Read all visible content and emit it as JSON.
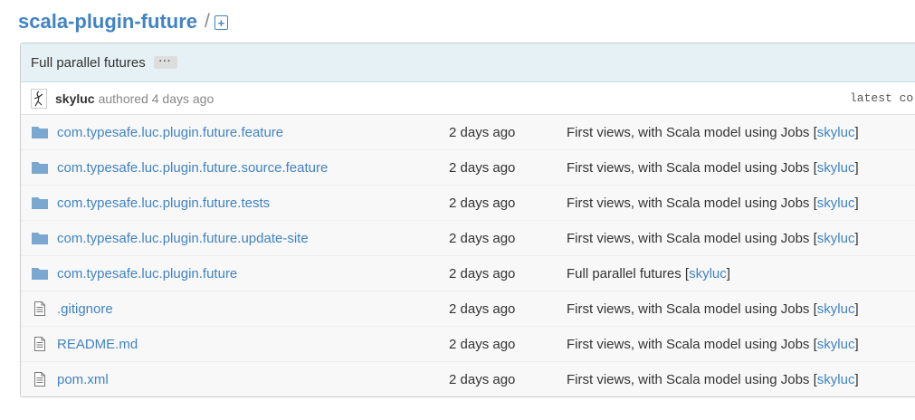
{
  "repo": {
    "name": "scala-plugin-future",
    "separator": "/"
  },
  "commit": {
    "title": "Full parallel futures",
    "ellipsis": "···",
    "author": "skyluc",
    "authored_text": "authored 4 days ago",
    "latest_label": "latest co"
  },
  "files": [
    {
      "type": "folder",
      "name": "com.typesafe.luc.plugin.future.feature",
      "age": "2 days ago",
      "message": "First views, with Scala model using Jobs",
      "msg_open": "[",
      "author": "skyluc",
      "msg_close": "]"
    },
    {
      "type": "folder",
      "name": "com.typesafe.luc.plugin.future.source.feature",
      "age": "2 days ago",
      "message": "First views, with Scala model using Jobs",
      "msg_open": "[",
      "author": "skyluc",
      "msg_close": "]"
    },
    {
      "type": "folder",
      "name": "com.typesafe.luc.plugin.future.tests",
      "age": "2 days ago",
      "message": "First views, with Scala model using Jobs",
      "msg_open": "[",
      "author": "skyluc",
      "msg_close": "]"
    },
    {
      "type": "folder",
      "name": "com.typesafe.luc.plugin.future.update-site",
      "age": "2 days ago",
      "message": "First views, with Scala model using Jobs",
      "msg_open": "[",
      "author": "skyluc",
      "msg_close": "]"
    },
    {
      "type": "folder",
      "name": "com.typesafe.luc.plugin.future",
      "age": "2 days ago",
      "message": "Full parallel futures",
      "msg_open": "[",
      "author": "skyluc",
      "msg_close": "]"
    },
    {
      "type": "file",
      "name": ".gitignore",
      "age": "2 days ago",
      "message": "First views, with Scala model using Jobs",
      "msg_open": "[",
      "author": "skyluc",
      "msg_close": "]"
    },
    {
      "type": "file",
      "name": "README.md",
      "age": "2 days ago",
      "message": "First views, with Scala model using Jobs",
      "msg_open": "[",
      "author": "skyluc",
      "msg_close": "]"
    },
    {
      "type": "file",
      "name": "pom.xml",
      "age": "2 days ago",
      "message": "First views, with Scala model using Jobs",
      "msg_open": "[",
      "author": "skyluc",
      "msg_close": "]"
    }
  ],
  "icons": {
    "folder": "folder-icon",
    "file": "file-icon",
    "new_file": "new-file-icon"
  },
  "colors": {
    "link": "#4183c4",
    "folder": "#7aa8d1",
    "title_bar": "#e6f1f6"
  }
}
